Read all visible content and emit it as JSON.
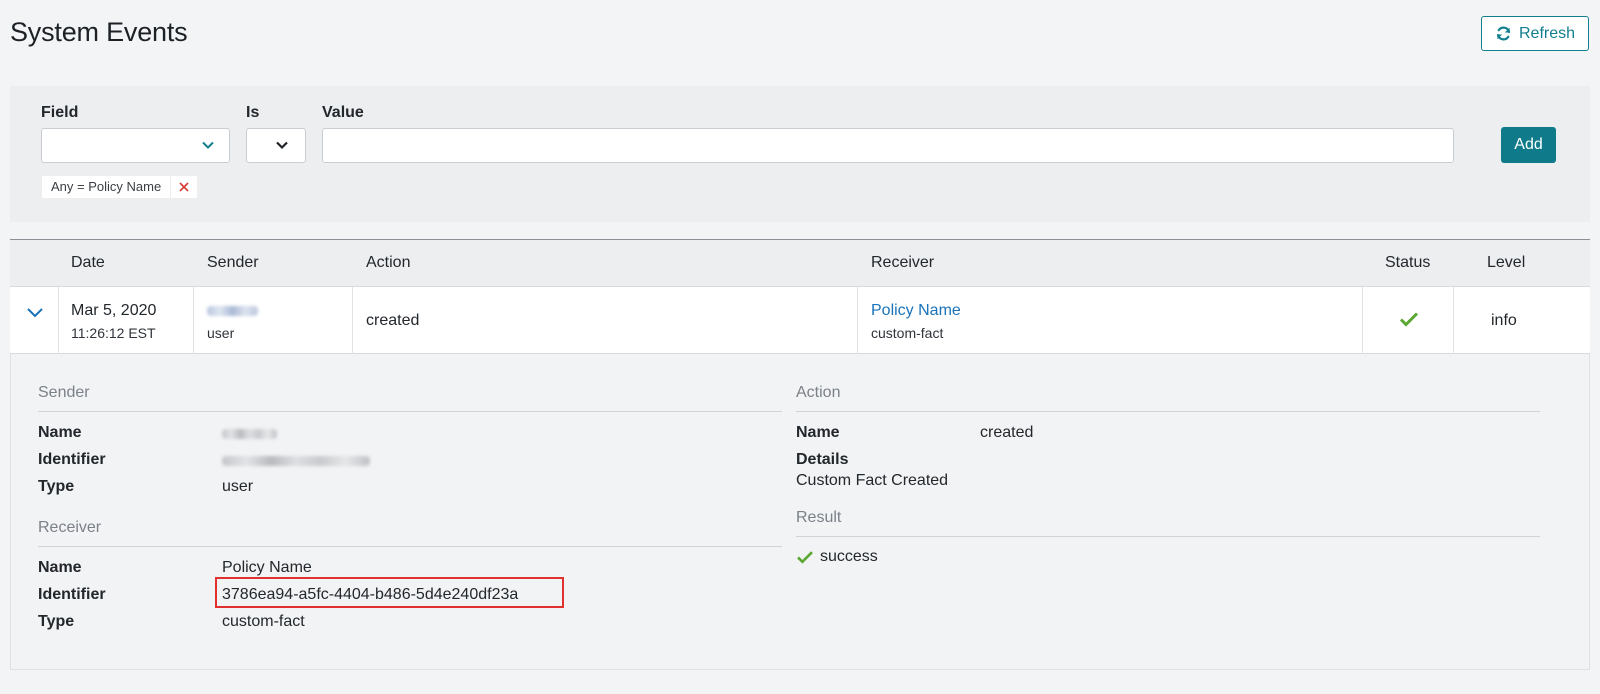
{
  "page": {
    "title": "System Events"
  },
  "toolbar": {
    "refresh_label": "Refresh"
  },
  "filter": {
    "field_label": "Field",
    "is_label": "Is",
    "value_label": "Value",
    "field_value": "",
    "is_value": "",
    "value_input": "",
    "add_label": "Add",
    "chips": [
      {
        "text": "Any = Policy Name"
      }
    ]
  },
  "table": {
    "columns": [
      "Date",
      "Sender",
      "Action",
      "Receiver",
      "Status",
      "Level"
    ],
    "rows": [
      {
        "date": "Mar 5, 2020",
        "time": "11:26:12 EST",
        "sender_type": "user",
        "action": "created",
        "receiver_name": "Policy Name",
        "receiver_type": "custom-fact",
        "status": "success",
        "level": "info"
      }
    ]
  },
  "detail": {
    "sender": {
      "title": "Sender",
      "name_label": "Name",
      "identifier_label": "Identifier",
      "type_label": "Type",
      "type": "user"
    },
    "receiver": {
      "title": "Receiver",
      "name_label": "Name",
      "identifier_label": "Identifier",
      "type_label": "Type",
      "name": "Policy Name",
      "identifier": "3786ea94-a5fc-4404-b486-5d4e240df23a",
      "type": "custom-fact"
    },
    "action": {
      "title": "Action",
      "name_label": "Name",
      "name": "created",
      "details_label": "Details",
      "details": "Custom Fact Created"
    },
    "result": {
      "title": "Result",
      "value": "success"
    }
  },
  "colors": {
    "accent": "#0f7b8a",
    "link": "#1a73b9",
    "success": "#5aa832",
    "highlight": "#e0312e",
    "remove": "#d63b32"
  }
}
